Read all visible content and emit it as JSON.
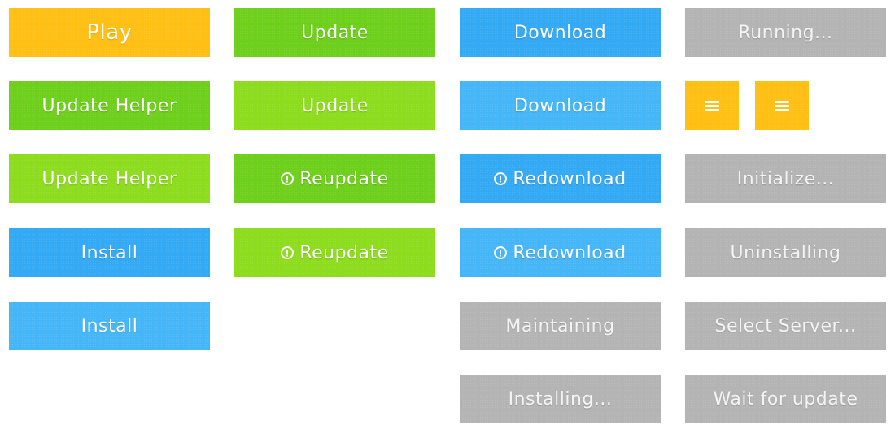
{
  "colors": {
    "yellow": "#ffbf14",
    "green": "#6ecf1c",
    "lime": "#8ddc1e",
    "blue": "#34a9f4",
    "sky": "#45b6f7",
    "gray": "#b4b4b4"
  },
  "buttons": {
    "play": "Play",
    "update": "Update",
    "update_hover": "Update",
    "download": "Download",
    "download_hover": "Download",
    "running": "Running...",
    "update_helper": "Update Helper",
    "update_helper_hover": "Update Helper",
    "reupdate": "Reupdate",
    "reupdate_hover": "Reupdate",
    "redownload": "Redownload",
    "redownload_hover": "Redownload",
    "initialize": "Initialize...",
    "install": "Install",
    "install_hover": "Install",
    "uninstalling": "Uninstalling",
    "maintaining": "Maintaining",
    "select_server": "Select Server...",
    "installing": "Installing...",
    "wait_for_update": "Wait for update"
  },
  "icons": {
    "menu": "hamburger-menu-icon",
    "warning": "exclamation-circle-icon"
  }
}
